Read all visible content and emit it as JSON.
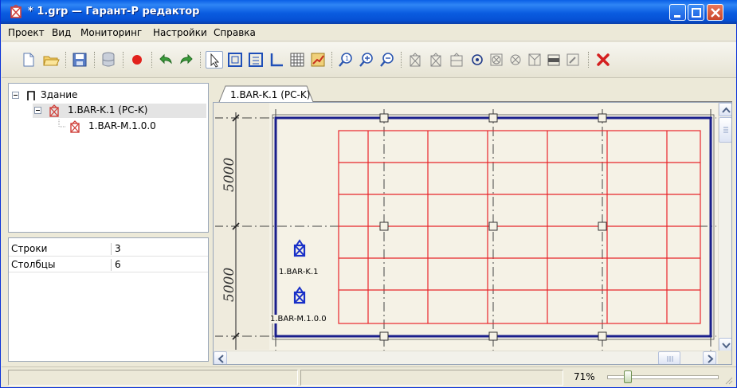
{
  "window": {
    "title": "* 1.grp — Гарант-Р редактор",
    "icon": "sensor-device-icon"
  },
  "menu": [
    "Проект",
    "Вид",
    "Мониторинг",
    "Настройки",
    "Справка"
  ],
  "toolbar": {
    "buttons": [
      "new-file-icon",
      "open-folder-icon",
      "save-icon",
      "database-icon",
      "record-icon",
      "undo-icon",
      "redo-icon",
      "pointer-icon",
      "select-region-icon",
      "select-node-icon",
      "corner-icon",
      "grid-icon",
      "chart-icon",
      "zoom-one-icon",
      "zoom-in-icon",
      "zoom-out-icon",
      "sensor-icon",
      "sensor-alt-icon",
      "sensor-frame-icon",
      "target-icon",
      "box-x-icon",
      "circle-x-icon",
      "funnel-icon",
      "bar-icon",
      "pen-icon",
      "delete-icon"
    ]
  },
  "tree": {
    "root": "Здание",
    "child": "1.BAR-K.1 (PC-K)",
    "leaf": "1.BAR-M.1.0.0"
  },
  "properties": [
    {
      "key": "Строки",
      "value": "3"
    },
    {
      "key": "Столбцы",
      "value": "6"
    }
  ],
  "tab": {
    "label": "1.BAR-K.1 (PC-K)"
  },
  "canvas": {
    "dim_top": "5000",
    "dim_bottom": "5000",
    "sensor_k_label": "1.BAR-K.1",
    "sensor_m_label": "1.BAR-M.1.0.0"
  },
  "status": {
    "zoom": "71%",
    "zoom_level": 0.16
  },
  "colors": {
    "grid_red": "#e8262b",
    "frame_blue": "#1a1f8c",
    "sensor_blue": "#1830c8"
  }
}
